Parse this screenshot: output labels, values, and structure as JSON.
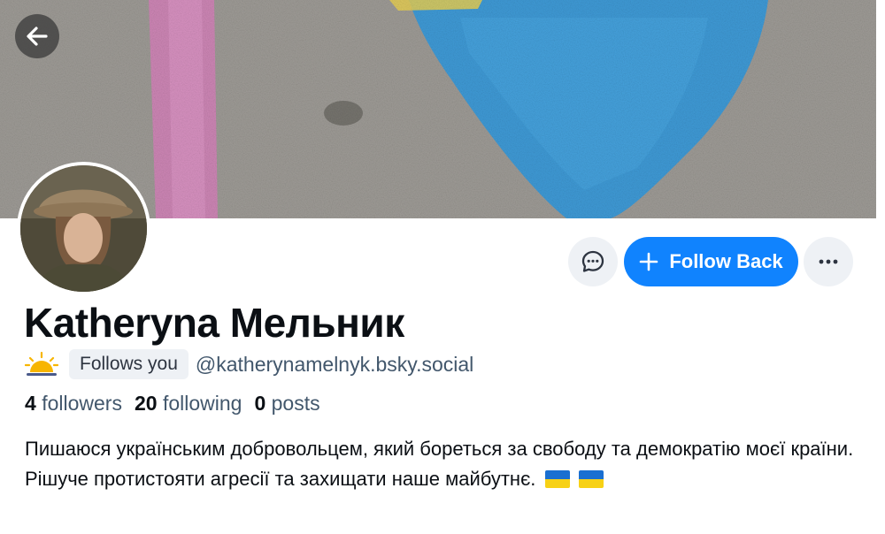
{
  "profile": {
    "display_name": "Katheryna Мельник",
    "follows_you_label": "Follows you",
    "handle": "@katherynamelnyk.bsky.social",
    "bio": "Пишаюся українським добровольцем, який бореться за свободу та демократію моєї країни.  Рішуче протистояти агресії та захищати наше майбутнє.",
    "bio_flags": [
      "ukraine-flag-emoji",
      "ukraine-flag-emoji"
    ]
  },
  "stats": {
    "followers_count": "4",
    "followers_label": "followers",
    "following_count": "20",
    "following_label": "following",
    "posts_count": "0",
    "posts_label": "posts"
  },
  "actions": {
    "follow_label": "Follow Back",
    "message_icon": "chat-bubble-icon",
    "more_icon": "ellipsis-icon",
    "back_icon": "arrow-left-icon"
  },
  "colors": {
    "accent": "#1083fe",
    "muted_text": "#42576c",
    "badge_bg": "#eef1f5"
  }
}
